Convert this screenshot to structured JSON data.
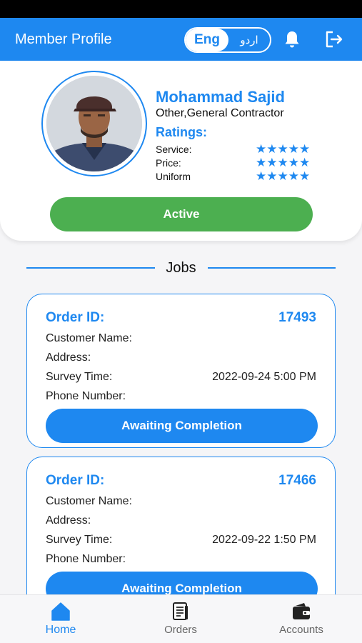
{
  "header": {
    "title": "Member Profile",
    "lang_english": "Eng",
    "lang_urdu": "اردو"
  },
  "profile": {
    "name": "Mohammad Sajid",
    "role": "Other,General Contractor",
    "ratings_title": "Ratings:",
    "ratings": [
      {
        "label": "Service:",
        "stars": 5
      },
      {
        "label": "Price:",
        "stars": 5
      },
      {
        "label": "Uniform",
        "stars": 5
      }
    ],
    "status_label": "Active"
  },
  "jobs": {
    "title": "Jobs",
    "items": [
      {
        "order_label": "Order ID:",
        "order_id": "17493",
        "customer_label": "Customer Name:",
        "address_label": "Address:",
        "survey_label": "Survey Time:",
        "survey_time": "2022-09-24 5:00 PM",
        "phone_label": "Phone Number:",
        "status": "Awaiting Completion"
      },
      {
        "order_label": "Order ID:",
        "order_id": "17466",
        "customer_label": "Customer Name:",
        "address_label": "Address:",
        "survey_label": "Survey Time:",
        "survey_time": "2022-09-22 1:50 PM",
        "phone_label": "Phone Number:",
        "status": "Awaiting Completion"
      }
    ]
  },
  "nav": {
    "items": [
      {
        "label": "Home",
        "icon": "home-icon",
        "active": true
      },
      {
        "label": "Orders",
        "icon": "orders-icon",
        "active": false
      },
      {
        "label": "Accounts",
        "icon": "wallet-icon",
        "active": false
      }
    ]
  },
  "colors": {
    "primary": "#1e88f0",
    "active_green": "#4caf50"
  }
}
